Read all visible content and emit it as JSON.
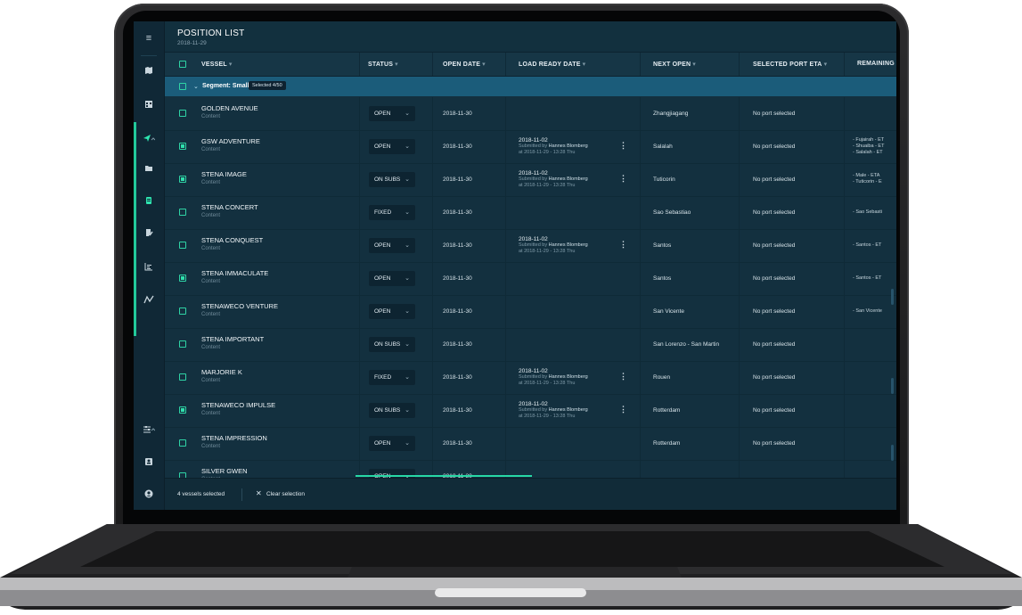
{
  "page": {
    "title": "POSITION LIST",
    "date": "2018-11-29"
  },
  "columns": {
    "vessel": "VESSEL",
    "status": "STATUS",
    "open_date": "OPEN DATE",
    "load_ready_date": "LOAD READY DATE",
    "next_open": "NEXT OPEN",
    "selected_port_eta": "SELECTED PORT ETA",
    "remaining": "REMAINING"
  },
  "icons": {
    "caret": "▾",
    "chevron": "⌄",
    "kebab": "⋮",
    "close": "✕",
    "menu": "≡"
  },
  "segment": {
    "label": "Segment: Small",
    "badge": "Selected 4/50"
  },
  "rows": [
    {
      "name": "GOLDEN AVENUE",
      "sub": "Content",
      "status": "OPEN",
      "open_date": "2018-11-30",
      "next_open": "Zhangjiagang",
      "eta": "No port selected",
      "checked": false
    },
    {
      "name": "GSW ADVENTURE",
      "sub": "Content",
      "status": "OPEN",
      "open_date": "2018-11-30",
      "lr_date": "2018-11-02",
      "lr_by": "Submitted by",
      "lr_user": "Hannes Blomberg",
      "lr_at": "at 2018-11-29 - 13:28 Thu",
      "next_open": "Salalah",
      "eta": "No port selected",
      "rem1": "- Fujairah - ET",
      "rem2": "- Shuaiba - ET",
      "rem3": "- Salalah - ET",
      "checked": true
    },
    {
      "name": "STENA IMAGE",
      "sub": "Content",
      "status": "ON SUBS",
      "open_date": "2018-11-30",
      "lr_date": "2018-11-02",
      "lr_by": "Submitted by",
      "lr_user": "Hannes Blomberg",
      "lr_at": "at 2018-11-29 - 13:28 Thu",
      "next_open": "Tuticorin",
      "eta": "No port selected",
      "rem1": "- Male - ETA",
      "rem2": "- Tuticorin - E",
      "checked": true
    },
    {
      "name": "STENA CONCERT",
      "sub": "Content",
      "status": "FIXED",
      "open_date": "2018-11-30",
      "next_open": "Sao Sebastiao",
      "eta": "No port selected",
      "rem1": "- Sao Sebasti",
      "checked": false
    },
    {
      "name": "STENA CONQUEST",
      "sub": "Content",
      "status": "OPEN",
      "open_date": "2018-11-30",
      "lr_date": "2018-11-02",
      "lr_by": "Submitted by",
      "lr_user": "Hannes Blomberg",
      "lr_at": "at 2018-11-29 - 13:28 Thu",
      "next_open": "Santos",
      "eta": "No port selected",
      "rem1": "- Santos - ET",
      "checked": false
    },
    {
      "name": "STENA IMMACULATE",
      "sub": "Content",
      "status": "OPEN",
      "open_date": "2018-11-30",
      "next_open": "Santos",
      "eta": "No port selected",
      "rem1": "- Santos - ET",
      "checked": true
    },
    {
      "name": "STENAWECO VENTURE",
      "sub": "Content",
      "status": "OPEN",
      "open_date": "2018-11-30",
      "next_open": "San Vicente",
      "eta": "No port selected",
      "rem1": "- San Vicente",
      "checked": false
    },
    {
      "name": "STENA IMPORTANT",
      "sub": "Content",
      "status": "ON SUBS",
      "open_date": "2018-11-30",
      "next_open": "San Lorenzo - San Martin",
      "eta": "No port selected",
      "checked": false
    },
    {
      "name": "MARJORIE K",
      "sub": "Content",
      "status": "FIXED",
      "open_date": "2018-11-30",
      "lr_date": "2018-11-02",
      "lr_by": "Submitted by",
      "lr_user": "Hannes Blomberg",
      "lr_at": "at 2018-11-29 - 13:28 Thu",
      "next_open": "Rouen",
      "eta": "No port selected",
      "checked": false
    },
    {
      "name": "STENAWECO IMPULSE",
      "sub": "Content",
      "status": "ON SUBS",
      "open_date": "2018-11-30",
      "lr_date": "2018-11-02",
      "lr_by": "Submitted by",
      "lr_user": "Hannes Blomberg",
      "lr_at": "at 2018-11-29 - 13:28 Thu",
      "next_open": "Rotterdam",
      "eta": "No port selected",
      "checked": true
    },
    {
      "name": "STENA IMPRESSION",
      "sub": "Content",
      "status": "OPEN",
      "open_date": "2018-11-30",
      "next_open": "Rotterdam",
      "eta": "No port selected",
      "checked": false
    },
    {
      "name": "SILVER GWEN",
      "sub": "Content",
      "status": "OPEN",
      "open_date": "2018-11-30",
      "next_open": "",
      "eta": "",
      "checked": false
    }
  ],
  "footer": {
    "selected": "4 vessels selected",
    "clear": "Clear selection"
  },
  "colors": {
    "accent": "#2ee6b0",
    "background": "#13303f",
    "segment": "#1b5c7a"
  }
}
